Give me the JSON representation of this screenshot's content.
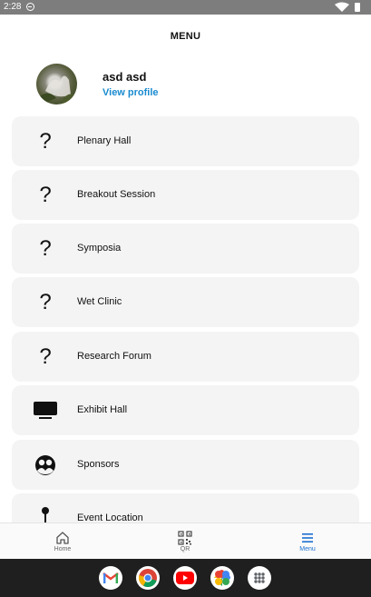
{
  "status_bar": {
    "time": "2:28"
  },
  "header": {
    "title": "MENU"
  },
  "profile": {
    "name": "asd asd",
    "link": "View profile"
  },
  "menu": [
    {
      "label": "Plenary Hall",
      "icon": "question-icon"
    },
    {
      "label": "Breakout Session",
      "icon": "question-icon"
    },
    {
      "label": "Symposia",
      "icon": "question-icon"
    },
    {
      "label": "Wet Clinic",
      "icon": "question-icon"
    },
    {
      "label": "Research Forum",
      "icon": "question-icon"
    },
    {
      "label": "Exhibit Hall",
      "icon": "tv-icon"
    },
    {
      "label": "Sponsors",
      "icon": "group-icon"
    },
    {
      "label": "Event Location",
      "icon": "map-pin-icon"
    }
  ],
  "bottom_nav": [
    {
      "label": "Home",
      "icon": "home-icon",
      "active": false
    },
    {
      "label": "QR",
      "icon": "qr-code-icon",
      "active": false
    },
    {
      "label": "Menu",
      "icon": "menu-icon",
      "active": true
    }
  ],
  "dock_apps": [
    "gmail-icon",
    "chrome-icon",
    "youtube-icon",
    "photos-icon",
    "app-drawer-icon"
  ],
  "colors": {
    "accent": "#1a8bd0",
    "active_nav": "#1a6fd0",
    "card_bg": "#f4f4f4",
    "status_bar": "#7d7d7d",
    "system_nav": "#1f1f1f"
  }
}
